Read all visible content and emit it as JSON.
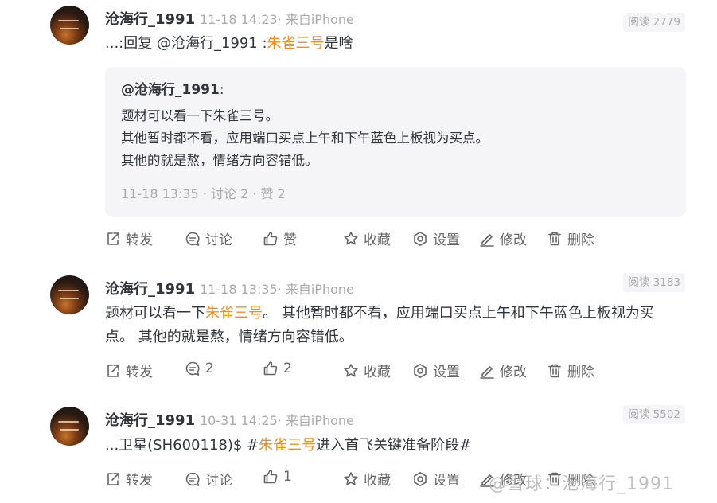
{
  "posts": [
    {
      "username": "沧海行_1991",
      "meta": "11-18 14:23· 来自iPhone",
      "read_label": "阅读 2779",
      "content_prefix": "...:回复 @沧海行_1991 :",
      "content_highlight": "朱雀三号",
      "content_suffix": "是啥",
      "quote": {
        "author": "@沧海行_1991",
        "colon": ":",
        "lines": [
          "题材可以看一下朱雀三号。",
          "其他暂时都不看，应用端口买点上午和下午蓝色上板视为买点。",
          "其他的就是熬，情绪方向容错低。"
        ],
        "meta": "11-18 13:35  · 讨论 2 · 赞 2"
      },
      "actions": {
        "repost": "转发",
        "comment": "讨论",
        "like": "赞",
        "favorite": "收藏",
        "settings": "设置",
        "edit": "修改",
        "delete": "删除"
      }
    },
    {
      "username": "沧海行_1991",
      "meta": "11-18 13:35· 来自iPhone",
      "read_label": "阅读 3183",
      "content_prefix": "题材可以看一下",
      "content_highlight": "朱雀三号",
      "content_suffix": "。 其他暂时都不看，应用端口买点上午和下午蓝色上板视为买点。 其他的就是熬，情绪方向容错低。",
      "actions": {
        "repost": "转发",
        "comment": "2",
        "like": "2",
        "favorite": "收藏",
        "settings": "设置",
        "edit": "修改",
        "delete": "删除"
      }
    },
    {
      "username": "沧海行_1991",
      "meta": "10-31 14:25· 来自iPhone",
      "read_label": "阅读 5502",
      "content_prefix": "...卫星(SH600118)$ #",
      "content_highlight": "朱雀三号",
      "content_suffix": "进入首飞关键准备阶段#",
      "actions": {
        "repost": "转发",
        "comment": "讨论",
        "like": "1",
        "favorite": "收藏",
        "settings": "设置",
        "edit": "修改",
        "delete": "删除"
      }
    }
  ],
  "watermark": "@雪球：沧海行_1991",
  "colors": {
    "highlight": "#f48d1e",
    "muted": "#aaaaaa",
    "text": "#33353c",
    "quote_bg": "#f5f5f7"
  },
  "icons": [
    "repost-icon",
    "comment-icon",
    "like-icon",
    "star-icon",
    "gear-icon",
    "edit-icon",
    "trash-icon"
  ]
}
